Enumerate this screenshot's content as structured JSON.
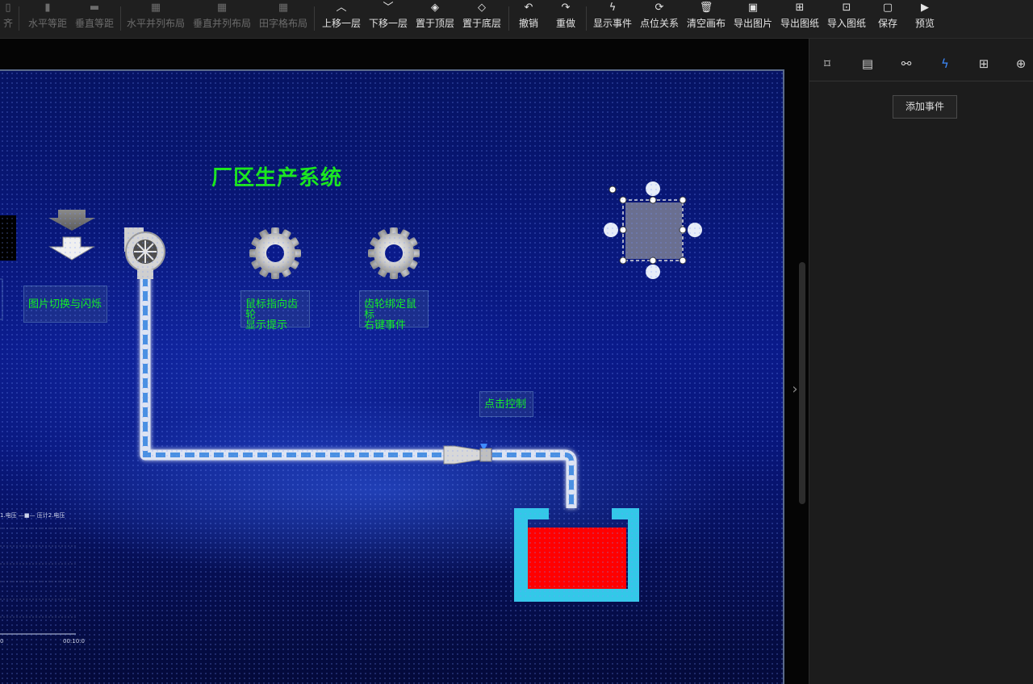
{
  "toolbar": {
    "items": [
      {
        "label": "齐",
        "icon": "align-icon",
        "enabled": false
      },
      {
        "label": "水平等距",
        "icon": "h-distribute-icon",
        "enabled": false
      },
      {
        "label": "垂直等距",
        "icon": "v-distribute-icon",
        "enabled": false
      },
      {
        "label": "水平并列布局",
        "icon": "h-layout-icon",
        "enabled": false
      },
      {
        "label": "垂直并列布局",
        "icon": "v-layout-icon",
        "enabled": false
      },
      {
        "label": "田字格布局",
        "icon": "grid-layout-icon",
        "enabled": false
      },
      {
        "label": "上移一层",
        "icon": "chevron-up-icon",
        "enabled": true
      },
      {
        "label": "下移一层",
        "icon": "chevron-down-icon",
        "enabled": true
      },
      {
        "label": "置于顶层",
        "icon": "layers-top-icon",
        "enabled": true
      },
      {
        "label": "置于底层",
        "icon": "layers-bottom-icon",
        "enabled": true
      },
      {
        "label": "撤销",
        "icon": "undo-icon",
        "enabled": true
      },
      {
        "label": "重做",
        "icon": "redo-icon",
        "enabled": true
      },
      {
        "label": "显示事件",
        "icon": "lightning-icon",
        "enabled": true
      },
      {
        "label": "点位关系",
        "icon": "refresh-icon",
        "enabled": true
      },
      {
        "label": "清空画布",
        "icon": "trash-icon",
        "enabled": true
      },
      {
        "label": "导出图片",
        "icon": "image-icon",
        "enabled": true
      },
      {
        "label": "导出图纸",
        "icon": "export-icon",
        "enabled": true
      },
      {
        "label": "导入图纸",
        "icon": "import-icon",
        "enabled": true
      },
      {
        "label": "保存",
        "icon": "save-icon",
        "enabled": true
      },
      {
        "label": "预览",
        "icon": "play-icon",
        "enabled": true
      }
    ]
  },
  "canvas": {
    "title": "厂区生产系统",
    "labels": {
      "image_switch": "图片切换与闪烁",
      "gear_hover_line1": "鼠标指向齿轮",
      "gear_hover_line2": "显示提示",
      "gear_bind_line1": "齿轮绑定鼠标",
      "gear_bind_line2": "右键事件",
      "click_control": "点击控制"
    },
    "colors": {
      "title": "#19e81b",
      "tank_fill": "#ff0000",
      "tank_frame": "#33c8e8",
      "pipe_flow": "#4a90e2"
    },
    "chart_legend": "1.电压  —■— 压计2.电压",
    "chart_x_start": "0",
    "chart_x_end": "00:10:0"
  },
  "right_panel": {
    "tabs": [
      {
        "icon": "frame-icon"
      },
      {
        "icon": "data-settings-icon"
      },
      {
        "icon": "nodes-icon"
      },
      {
        "icon": "lightning-icon",
        "active": true
      },
      {
        "icon": "layout-icon"
      },
      {
        "icon": "target-icon"
      }
    ],
    "add_event_label": "添加事件"
  }
}
